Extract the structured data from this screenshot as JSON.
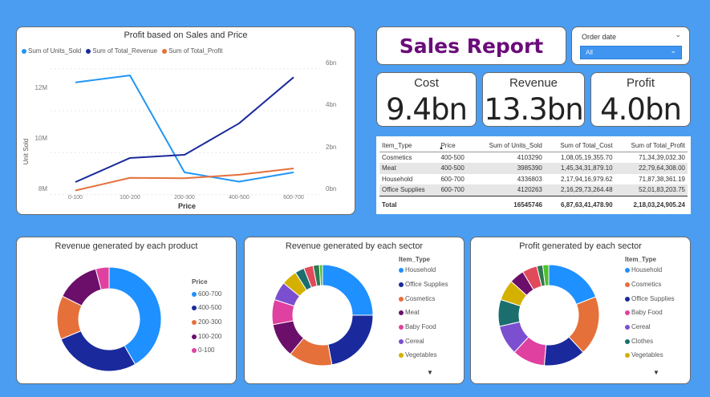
{
  "line_chart": {
    "title": "Profit based on Sales and Price",
    "legend": [
      {
        "label": "Sum of Units_Sold",
        "color": "#2196f3"
      },
      {
        "label": "Sum of Total_Revenue",
        "color": "#1a2a9c"
      },
      {
        "label": "Sum of Total_Profit",
        "color": "#e5703a"
      }
    ],
    "y_label": "Unit Sold",
    "x_label": "Price",
    "left_ticks": [
      "12M",
      "10M",
      "8M"
    ],
    "right_ticks": [
      "6bn",
      "4bn",
      "2bn",
      "0bn"
    ]
  },
  "chart_data": {
    "type": "line",
    "categories": [
      "0-100",
      "100-200",
      "200-300",
      "400-500",
      "600-700"
    ],
    "series": [
      {
        "name": "Sum of Units_Sold",
        "axis": "left",
        "values": [
          12.35,
          12.65,
          8.5,
          8.1,
          8.5
        ]
      },
      {
        "name": "Sum of Total_Revenue",
        "axis": "right",
        "values": [
          0.6,
          1.75,
          1.9,
          3.4,
          5.6
        ]
      },
      {
        "name": "Sum of Total_Profit",
        "axis": "right",
        "values": [
          0.2,
          0.8,
          0.78,
          0.95,
          1.25
        ]
      }
    ],
    "ylim_left": [
      7.5,
      13.2
    ],
    "ylim_right": [
      -0.05,
      6.3
    ]
  },
  "header": {
    "title": "Sales Report"
  },
  "filter": {
    "label": "Order date",
    "value": "All"
  },
  "kpis": [
    {
      "label": "Cost",
      "value": "9.4bn"
    },
    {
      "label": "Revenue",
      "value": "13.3bn"
    },
    {
      "label": "Profit",
      "value": "4.0bn"
    }
  ],
  "table": {
    "columns": [
      "Item_Type",
      "Price",
      "Sum of Units_Sold",
      "Sum of Total_Cost",
      "Sum of Total_Profit"
    ],
    "rows": [
      [
        "Cosmetics",
        "400-500",
        "4103290",
        "1,08,05,19,355.70",
        "71,34,39,032.30"
      ],
      [
        "Meat",
        "400-500",
        "3985390",
        "1,45,34,31,879.10",
        "22,79,64,308.00"
      ],
      [
        "Household",
        "600-700",
        "4336803",
        "2,17,94,16,979.62",
        "71,87,38,361.19"
      ],
      [
        "Office Supplies",
        "600-700",
        "4120263",
        "2,16,29,73,264.48",
        "52,01,83,203.75"
      ]
    ],
    "total": [
      "Total",
      "",
      "16545746",
      "6,87,63,41,478.90",
      "2,18,03,24,905.24"
    ]
  },
  "donut1": {
    "title": "Revenue generated by each product",
    "legend_title": "Price",
    "slices": [
      {
        "label": "600-700",
        "color": "#1e90ff",
        "value": 40
      },
      {
        "label": "400-500",
        "color": "#1a2a9c",
        "value": 26
      },
      {
        "label": "200-300",
        "color": "#e5703a",
        "value": 13
      },
      {
        "label": "100-200",
        "color": "#6b0f6b",
        "value": 13
      },
      {
        "label": "0-100",
        "color": "#e040a0",
        "value": 4
      }
    ]
  },
  "donut2": {
    "title": "Revenue generated by each sector",
    "legend_title": "Item_Type",
    "legend": [
      "Household",
      "Office Supplies",
      "Cosmetics",
      "Meat",
      "Baby Food",
      "Cereal",
      "Vegetables"
    ],
    "slices": [
      {
        "color": "#1e90ff",
        "value": 25
      },
      {
        "color": "#1a2a9c",
        "value": 22
      },
      {
        "color": "#e5703a",
        "value": 14
      },
      {
        "color": "#6b0f6b",
        "value": 11
      },
      {
        "color": "#e040a0",
        "value": 8
      },
      {
        "color": "#7b4fd0",
        "value": 6
      },
      {
        "color": "#d4b000",
        "value": 5
      },
      {
        "color": "#1a6e6e",
        "value": 3
      },
      {
        "color": "#e04a5a",
        "value": 3
      },
      {
        "color": "#2e7a50",
        "value": 2
      },
      {
        "color": "#4ec02e",
        "value": 1
      }
    ]
  },
  "donut3": {
    "title": "Profit generated by each sector",
    "legend_title": "Item_Type",
    "legend": [
      "Household",
      "Cosmetics",
      "Office Supplies",
      "Baby Food",
      "Cereal",
      "Clothes",
      "Vegetables"
    ],
    "slices": [
      {
        "color": "#1e90ff",
        "value": 20
      },
      {
        "color": "#e5703a",
        "value": 20
      },
      {
        "color": "#1a2a9c",
        "value": 14
      },
      {
        "color": "#e040a0",
        "value": 11
      },
      {
        "color": "#7b4fd0",
        "value": 10
      },
      {
        "color": "#1a6e6e",
        "value": 9
      },
      {
        "color": "#d4b000",
        "value": 7
      },
      {
        "color": "#6b0f6b",
        "value": 5
      },
      {
        "color": "#e04a5a",
        "value": 5
      },
      {
        "color": "#2e7a50",
        "value": 2
      },
      {
        "color": "#4ec02e",
        "value": 2
      }
    ]
  }
}
